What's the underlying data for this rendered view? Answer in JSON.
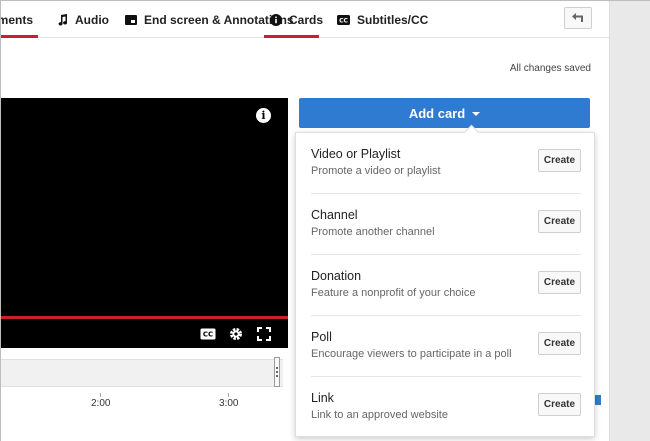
{
  "tabs": [
    {
      "label": "ements",
      "icon": "elements-icon"
    },
    {
      "label": "Audio",
      "icon": "music-note-icon"
    },
    {
      "label": "End screen & Annotations",
      "icon": "end-screen-icon"
    },
    {
      "label": "Cards",
      "icon": "info-icon"
    },
    {
      "label": "Subtitles/CC",
      "icon": "cc-icon"
    }
  ],
  "status": {
    "saved_text": "All changes saved"
  },
  "player": {
    "progress_fraction": 1.0,
    "controls": [
      "cc-icon",
      "gear-icon",
      "fullscreen-icon"
    ]
  },
  "timeline": {
    "ticks": [
      "2:00",
      "3:00"
    ]
  },
  "add_card": {
    "label": "Add card"
  },
  "card_types": [
    {
      "title": "Video or Playlist",
      "description": "Promote a video or playlist",
      "button": "Create"
    },
    {
      "title": "Channel",
      "description": "Promote another channel",
      "button": "Create"
    },
    {
      "title": "Donation",
      "description": "Feature a nonprofit of your choice",
      "button": "Create"
    },
    {
      "title": "Poll",
      "description": "Encourage viewers to participate in a poll",
      "button": "Create"
    },
    {
      "title": "Link",
      "description": "Link to an approved website",
      "button": "Create"
    }
  ],
  "colors": {
    "accent": "#2f7bd1",
    "tab_underline": "#cc1f2b",
    "progress": "#cc1f2b"
  }
}
